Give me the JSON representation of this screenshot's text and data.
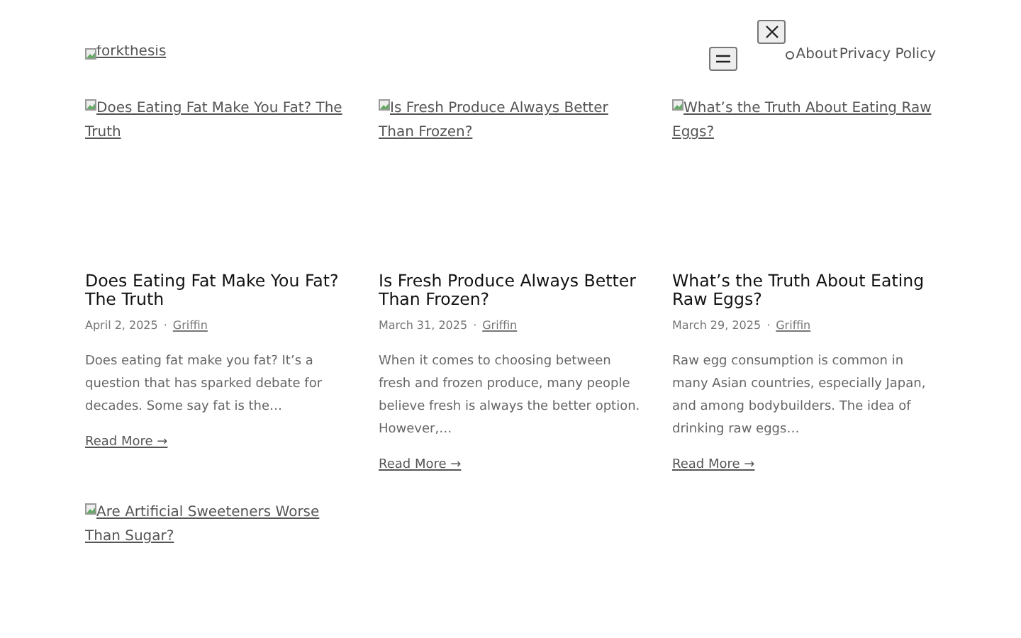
{
  "header": {
    "logo_alt": "forkthesis",
    "nav": [
      "About",
      "Privacy Policy"
    ]
  },
  "posts": [
    {
      "image_alt": "Does Eating Fat Make You Fat? The Truth",
      "title": "Does Eating Fat Make You Fat? The Truth",
      "date": "April 2, 2025",
      "separator": "·",
      "author": "Griffin",
      "excerpt": "Does eating fat make you fat? It’s a question that has sparked debate for decades. Some say fat is the…",
      "link": "Read More →"
    },
    {
      "image_alt": "Is Fresh Produce Always Better Than Frozen?",
      "title": "Is Fresh Produce Always Better Than Frozen?",
      "date": "March 31, 2025",
      "separator": "·",
      "author": "Griffin",
      "excerpt": "When it comes to choosing between fresh and frozen produce, many people believe fresh is always the better option. However,…",
      "link": "Read More →"
    },
    {
      "image_alt": "What’s the Truth About Eating Raw Eggs?",
      "title": "What’s the Truth About Eating Raw Eggs?",
      "date": "March 29, 2025",
      "separator": "·",
      "author": "Griffin",
      "excerpt": "Raw egg consumption is common in many Asian countries, especially Japan, and among bodybuilders. The idea of drinking raw eggs…",
      "link": "Read More →"
    },
    {
      "image_alt": "Are Artificial Sweeteners Worse Than Sugar?"
    }
  ]
}
